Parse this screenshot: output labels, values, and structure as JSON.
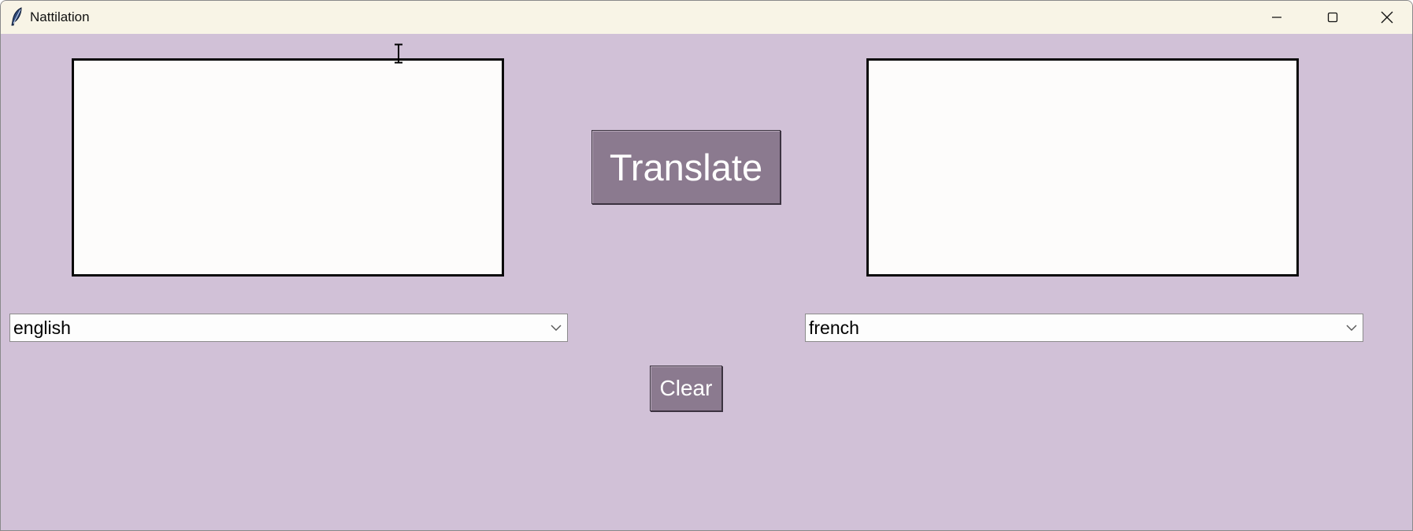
{
  "window": {
    "title": "Nattilation",
    "app_icon": "feather-icon",
    "controls": {
      "minimize_icon": "minimize-icon",
      "maximize_icon": "maximize-icon",
      "close_icon": "close-icon"
    }
  },
  "source": {
    "text": "",
    "language": "english"
  },
  "target": {
    "text": "",
    "language": "french"
  },
  "buttons": {
    "translate_label": "Translate",
    "clear_label": "Clear"
  },
  "colors": {
    "background": "#d1c1d7",
    "button": "#8b7a8f",
    "button_text": "#ffffff",
    "textbox": "#fdfcfb",
    "titlebar": "#f8f4e6"
  },
  "cursor": "text-cursor-icon"
}
